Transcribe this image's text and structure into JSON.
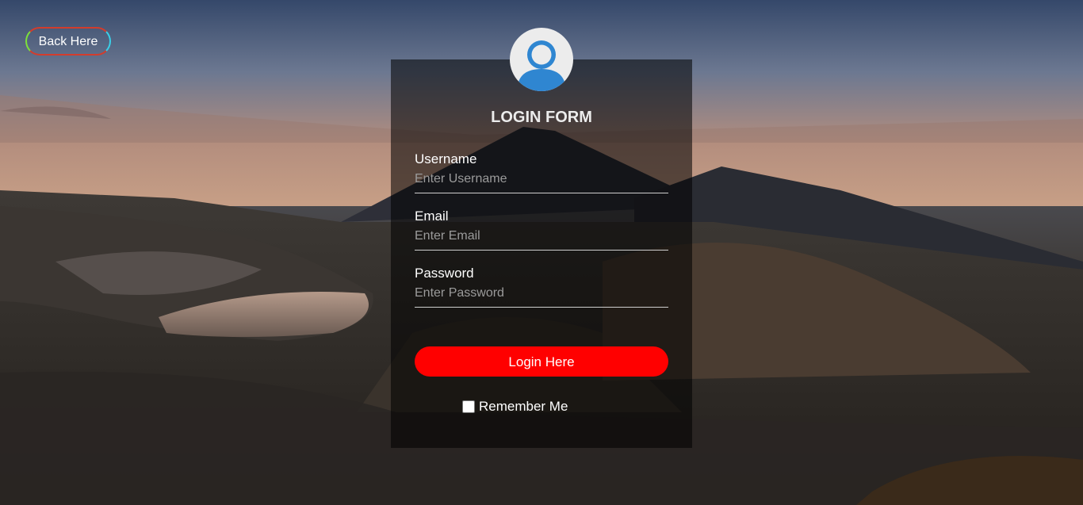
{
  "back_button": {
    "label": "Back Here"
  },
  "form": {
    "title": "LOGIN FORM",
    "fields": [
      {
        "label": "Username",
        "placeholder": "Enter Username",
        "value": ""
      },
      {
        "label": "Email",
        "placeholder": "Enter Email",
        "value": ""
      },
      {
        "label": "Password",
        "placeholder": "Enter Password",
        "value": ""
      }
    ],
    "submit_label": "Login Here",
    "remember_label": "Remember Me",
    "remember_checked": false
  },
  "colors": {
    "submit_bg": "#ff0000",
    "panel_bg": "rgba(0,0,0,0.55)",
    "avatar_icon": "#2f86d1"
  },
  "icons": {
    "avatar": "user-avatar-icon"
  }
}
